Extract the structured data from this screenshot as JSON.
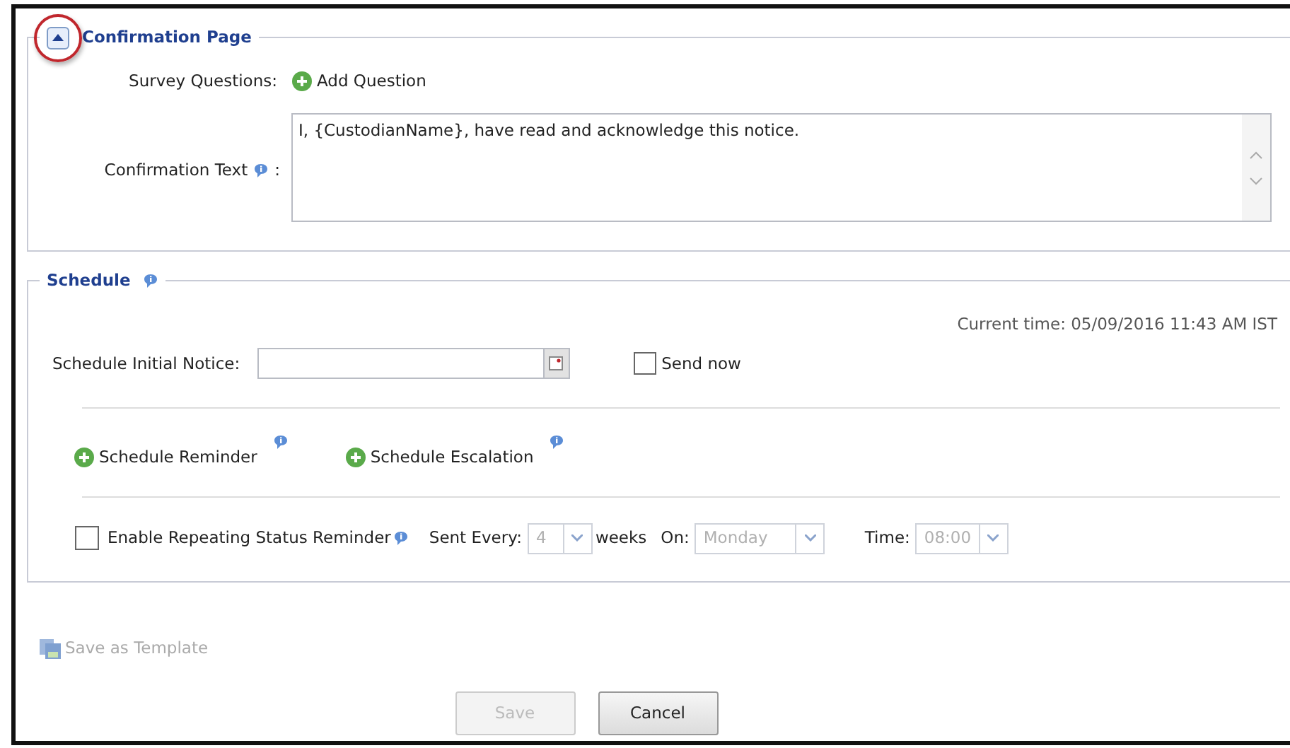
{
  "confirmation_section": {
    "title": "Confirmation Page",
    "expanded": true,
    "highlighted": true,
    "survey_label": "Survey Questions:",
    "add_question": "Add Question",
    "text_label": "Confirmation Text",
    "text_colon": ":",
    "text_value": "I, {CustodianName}, have read and acknowledge this notice."
  },
  "schedule_section": {
    "title": "Schedule",
    "current_time": "Current time: 05/09/2016 11:43 AM IST",
    "initial_label": "Schedule Initial Notice:",
    "send_now": {
      "label": "Send now",
      "checked": false
    },
    "actions": [
      "Schedule Reminder",
      "Schedule Escalation"
    ],
    "repeat": {
      "label": "Enable Repeating Status Reminder",
      "checked": false,
      "fields": [
        {
          "label": "Sent Every:",
          "value": "4",
          "after": "weeks",
          "disabled": true
        },
        {
          "label": "On:",
          "value": "Monday",
          "disabled": true
        },
        {
          "label": "Time:",
          "value": "08:00",
          "disabled": true
        }
      ]
    }
  },
  "save_template": {
    "label": "Save as Template",
    "disabled": true
  },
  "buttons": [
    {
      "label": "Save",
      "disabled": true
    },
    {
      "label": "Cancel",
      "disabled": false
    }
  ]
}
